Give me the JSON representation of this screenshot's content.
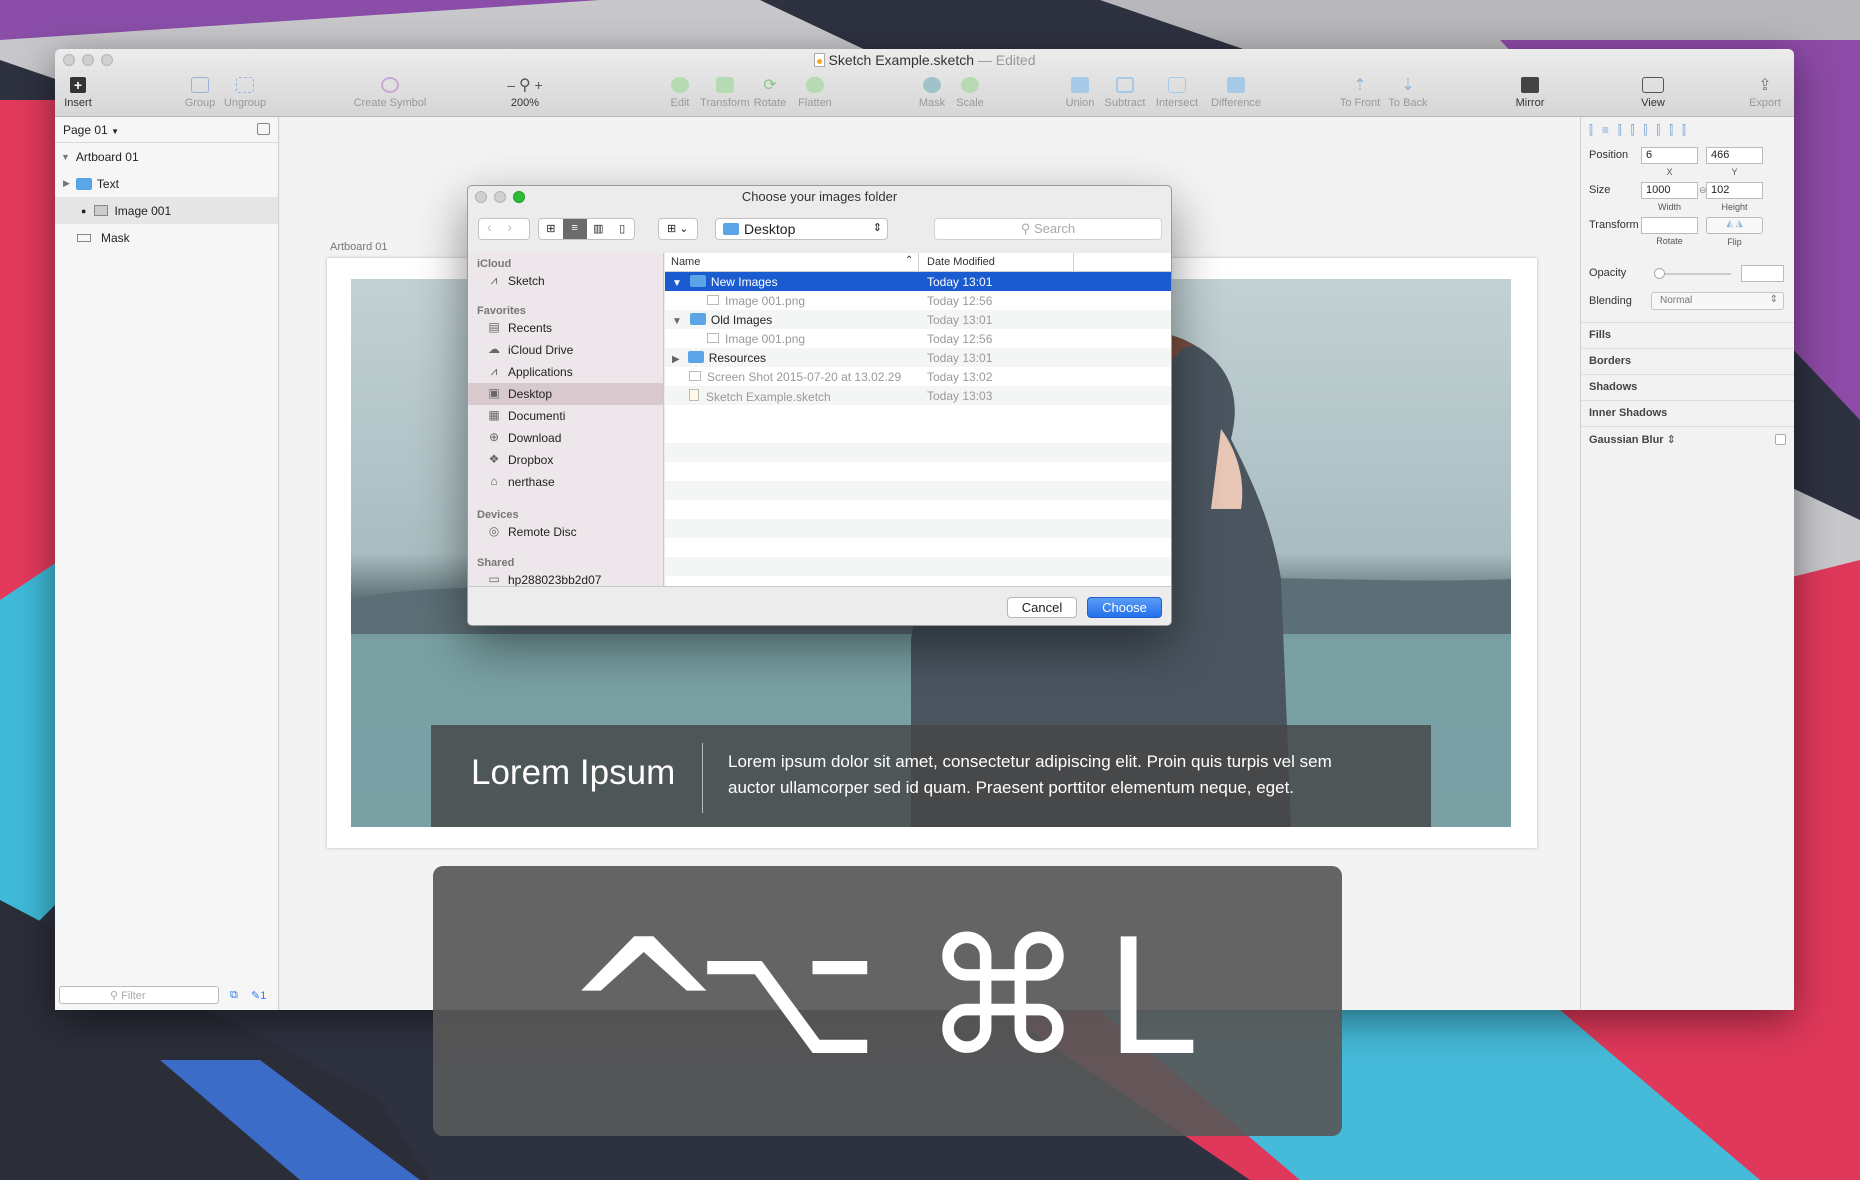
{
  "window": {
    "title": "Sketch Example.sketch",
    "status": "Edited"
  },
  "toolbar": {
    "insert": "Insert",
    "group": "Group",
    "ungroup": "Ungroup",
    "create_symbol": "Create Symbol",
    "zoom": "200%",
    "edit": "Edit",
    "transform": "Transform",
    "rotate": "Rotate",
    "flatten": "Flatten",
    "mask": "Mask",
    "scale": "Scale",
    "union": "Union",
    "subtract": "Subtract",
    "intersect": "Intersect",
    "difference": "Difference",
    "to_front": "To Front",
    "to_back": "To Back",
    "mirror": "Mirror",
    "view": "View",
    "export": "Export"
  },
  "layers": {
    "page": "Page 01",
    "items": [
      "Artboard 01",
      "Text",
      "Image 001",
      "Mask"
    ],
    "filter_placeholder": "Filter",
    "badge_count": "1"
  },
  "canvas": {
    "artboard_label": "Artboard 01",
    "caption_title": "Lorem Ipsum",
    "caption_body": "Lorem ipsum dolor sit amet, consectetur adipiscing elit. Proin quis turpis vel sem auctor ullamcorper sed id quam. Praesent porttitor elementum neque, eget."
  },
  "inspector": {
    "position_label": "Position",
    "x": "6",
    "y": "466",
    "x_sub": "X",
    "y_sub": "Y",
    "size_label": "Size",
    "width": "1000",
    "height": "102",
    "width_sub": "Width",
    "height_sub": "Height",
    "transform_label": "Transform",
    "rotate_sub": "Rotate",
    "flip_sub": "Flip",
    "opacity_label": "Opacity",
    "blending_label": "Blending",
    "blending_value": "Normal",
    "sections": [
      "Fills",
      "Borders",
      "Shadows",
      "Inner Shadows",
      "Gaussian Blur"
    ]
  },
  "dialog": {
    "title": "Choose your images folder",
    "location": "Desktop",
    "search_placeholder": "Search",
    "sidebar": {
      "icloud_header": "iCloud",
      "icloud_items": [
        "Sketch"
      ],
      "favorites_header": "Favorites",
      "favorites": [
        "Recents",
        "iCloud Drive",
        "Applications",
        "Desktop",
        "Documenti",
        "Download",
        "Dropbox",
        "nerthase"
      ],
      "devices_header": "Devices",
      "devices": [
        "Remote Disc"
      ],
      "shared_header": "Shared",
      "shared": [
        "hp288023bb2d07"
      ]
    },
    "columns": {
      "name": "Name",
      "date": "Date Modified"
    },
    "files": [
      {
        "name": "New Images",
        "date": "Today 13:01"
      },
      {
        "name": "Image 001.png",
        "date": "Today 12:56"
      },
      {
        "name": "Old Images",
        "date": "Today 13:01"
      },
      {
        "name": "Image 001.png",
        "date": "Today 12:56"
      },
      {
        "name": "Resources",
        "date": "Today 13:01"
      },
      {
        "name": "Screen Shot 2015-07-20 at 13.02.29",
        "date": "Today 13:02"
      },
      {
        "name": "Sketch Example.sketch",
        "date": "Today 13:03"
      }
    ],
    "cancel": "Cancel",
    "choose": "Choose"
  },
  "shortcut": {
    "ctrl": "^",
    "option": "⌥",
    "command": "⌘",
    "key": "L"
  },
  "colors": {
    "selection": "#1a5ccf",
    "accent_button": "#2f7cf0",
    "folder": "#5aa5e8"
  }
}
